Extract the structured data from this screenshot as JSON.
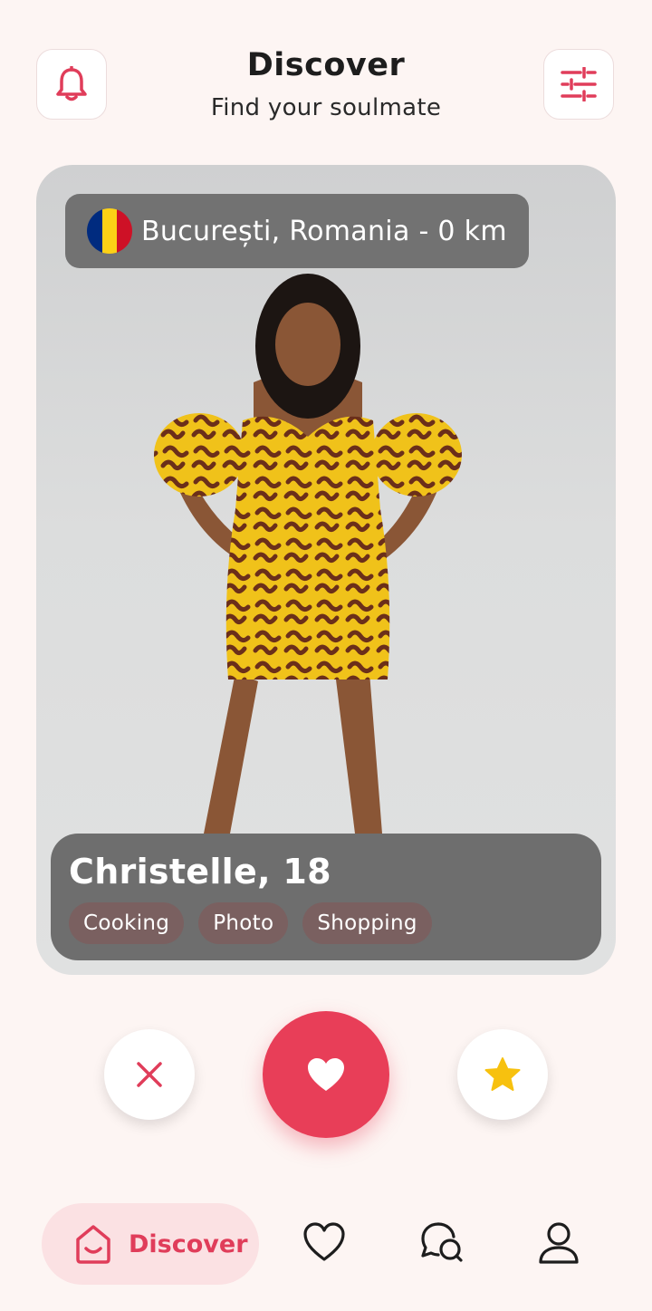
{
  "header": {
    "title": "Discover",
    "subtitle": "Find your soulmate",
    "notification_icon": "bell-icon",
    "filter_icon": "sliders-icon"
  },
  "card": {
    "location": "București, Romania - 0 km",
    "flag_colors": [
      "#002B7F",
      "#FCD116",
      "#CE1126"
    ],
    "name_age": "Christelle, 18",
    "interests": [
      "Cooking",
      "Photo",
      "Shopping"
    ]
  },
  "actions": {
    "dislike_icon": "close-icon",
    "like_icon": "heart-icon",
    "superlike_icon": "star-icon"
  },
  "nav": {
    "discover_label": "Discover",
    "items": [
      "home-icon",
      "heart-icon",
      "chat-icon",
      "user-icon"
    ]
  },
  "colors": {
    "accent": "#e83e58",
    "background": "#fdf5f3",
    "star": "#f7c10f"
  }
}
